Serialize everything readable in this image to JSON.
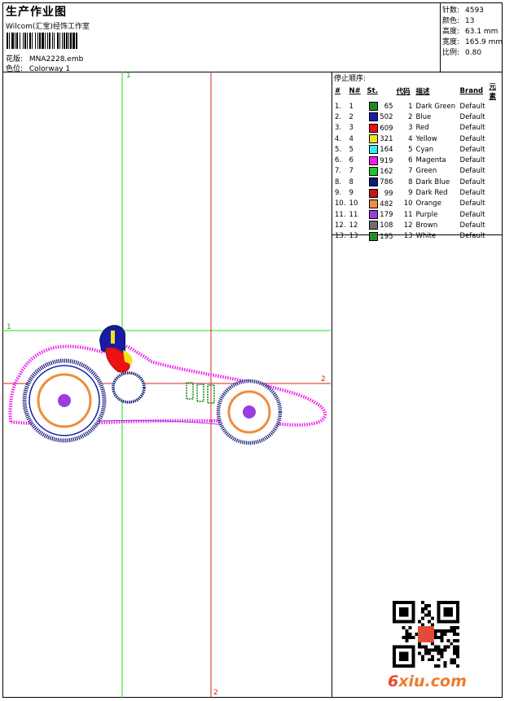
{
  "header": {
    "title": "生产作业图",
    "software": "Wilcom(汇宝)经饰工作室",
    "design_label": "花版:",
    "design_file": "MNA2228.emb",
    "colorway_label": "色位:",
    "colorway": "Colorway 1"
  },
  "stats": {
    "stitches_label": "针数:",
    "stitches": "4593",
    "colors_label": "颜色:",
    "colors": "13",
    "height_label": "高度:",
    "height": "63.1 mm",
    "width_label": "宽度:",
    "width": "165.9 mm",
    "scale_label": "比例:",
    "scale": "0.80"
  },
  "sequence": {
    "title": "停止顺序:",
    "columns": [
      "#",
      "N#",
      "St.",
      "代码",
      "描述",
      "Brand",
      "元素"
    ],
    "rows": [
      {
        "idx": "1.",
        "n": "1",
        "color": "#1f8a1f",
        "st": "65",
        "code": "1",
        "desc": "Dark Green",
        "brand": "Default"
      },
      {
        "idx": "2.",
        "n": "2",
        "color": "#1a1aa8",
        "st": "502",
        "code": "2",
        "desc": "Blue",
        "brand": "Default"
      },
      {
        "idx": "3.",
        "n": "3",
        "color": "#ee1111",
        "st": "609",
        "code": "3",
        "desc": "Red",
        "brand": "Default"
      },
      {
        "idx": "4.",
        "n": "4",
        "color": "#f2e21a",
        "st": "321",
        "code": "4",
        "desc": "Yellow",
        "brand": "Default"
      },
      {
        "idx": "5.",
        "n": "5",
        "color": "#2ef0f0",
        "st": "164",
        "code": "5",
        "desc": "Cyan",
        "brand": "Default"
      },
      {
        "idx": "6.",
        "n": "6",
        "color": "#f01ef0",
        "st": "919",
        "code": "6",
        "desc": "Magenta",
        "brand": "Default"
      },
      {
        "idx": "7.",
        "n": "7",
        "color": "#22c422",
        "st": "162",
        "code": "7",
        "desc": "Green",
        "brand": "Default"
      },
      {
        "idx": "8.",
        "n": "8",
        "color": "#101c78",
        "st": "786",
        "code": "8",
        "desc": "Dark Blue",
        "brand": "Default"
      },
      {
        "idx": "9.",
        "n": "9",
        "color": "#c81414",
        "st": "99",
        "code": "9",
        "desc": "Dark Red",
        "brand": "Default"
      },
      {
        "idx": "10.",
        "n": "10",
        "color": "#f08c3c",
        "st": "482",
        "code": "10",
        "desc": "Orange",
        "brand": "Default"
      },
      {
        "idx": "11.",
        "n": "11",
        "color": "#9a3ee0",
        "st": "179",
        "code": "11",
        "desc": "Purple",
        "brand": "Default"
      },
      {
        "idx": "12.",
        "n": "12",
        "color": "#6e6e6e",
        "st": "108",
        "code": "12",
        "desc": "Brown",
        "brand": "Default"
      },
      {
        "idx": "13.",
        "n": "13",
        "color": "#2a8c2a",
        "st": "195",
        "code": "13",
        "desc": "White",
        "brand": "Default"
      }
    ]
  },
  "guides": {
    "green_top": "1",
    "green_left": "1",
    "red_right": "2",
    "red_bottom": "2"
  },
  "watermark": {
    "prefix": "6",
    "rest": "xiu.com"
  }
}
